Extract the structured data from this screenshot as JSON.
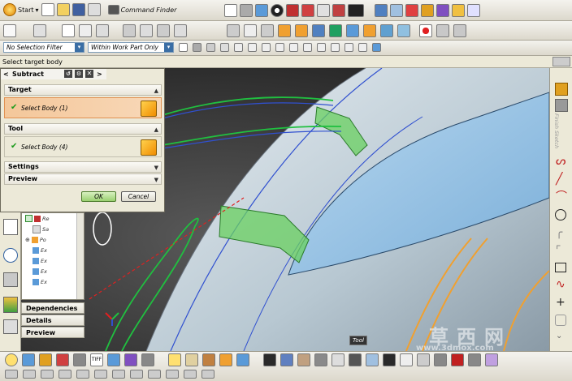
{
  "toolbar": {
    "start_label": "Start",
    "command_finder_label": "Command Finder"
  },
  "filters": {
    "selection_filter": "No Selection Filter",
    "scope": "Within Work Part Only"
  },
  "status": {
    "prompt": "Select target body"
  },
  "dialog": {
    "title": "Subtract",
    "target_section": "Target",
    "target_select": "Select Body (1)",
    "tool_section": "Tool",
    "tool_select": "Select Body (4)",
    "settings_section": "Settings",
    "preview_section": "Preview",
    "ok_label": "OK",
    "cancel_label": "Cancel"
  },
  "navigator": {
    "rows": [
      "Re",
      "Sa",
      "Po",
      "Ex",
      "Ex",
      "Ex",
      "Ex"
    ]
  },
  "lower_panels": {
    "dependencies": "Dependencies",
    "details": "Details",
    "preview": "Preview"
  },
  "right_panel": {
    "vertical_label": "Finish Sketch"
  },
  "viewport": {
    "tooltip_label": "Tool"
  },
  "watermark": {
    "chinese": "草西网",
    "url": "www.3dmox.com"
  },
  "colors": {
    "accent_orange": "#f0a030",
    "check_green": "#1a9a1a",
    "surface_blue": "#9fc8e8",
    "curve_green": "#20c040",
    "curve_blue": "#3050d0"
  }
}
